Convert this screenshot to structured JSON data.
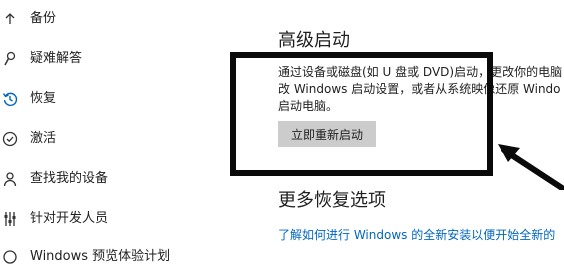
{
  "sidebar": {
    "items": [
      {
        "label": "备份",
        "icon": "backup-icon"
      },
      {
        "label": "疑难解答",
        "icon": "wrench-icon"
      },
      {
        "label": "恢复",
        "icon": "recovery-history-icon",
        "active": true
      },
      {
        "label": "激活",
        "icon": "activation-check-icon"
      },
      {
        "label": "查找我的设备",
        "icon": "person-location-icon"
      },
      {
        "label": "针对开发人员",
        "icon": "developer-sliders-icon"
      },
      {
        "label": "Windows 预览体验计划",
        "icon": "windows-insider-icon"
      }
    ]
  },
  "main": {
    "advanced_startup": {
      "title": "高级启动",
      "description_lines": [
        "通过设备或磁盘(如 U 盘或 DVD)启动，更改你的电脑",
        "改 Windows 启动设置，或者从系统映像还原 Windo",
        "启动电脑。"
      ],
      "button_label": "立即重新启动"
    },
    "more_options": {
      "title": "更多恢复选项",
      "link_text": "了解如何进行 Windows 的全新安装以便开始全新的"
    }
  },
  "colors": {
    "accent": "#0067c0",
    "button_bg": "#cccccc",
    "annotation": "#0a0a0a"
  }
}
